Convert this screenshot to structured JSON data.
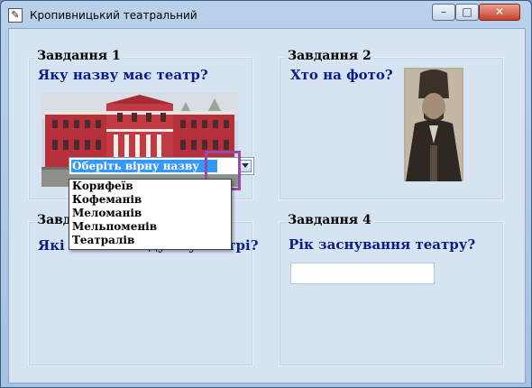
{
  "window": {
    "title": "Кропивницький театральний",
    "controls": {
      "minimize": "–",
      "maximize": "□",
      "close": "✕"
    }
  },
  "task1": {
    "title": "Завдання 1",
    "question": "Яку назву має театр?",
    "image": "theatre-building-photo",
    "select": {
      "value": "Оберіть вірну назву",
      "options": [
        "Корифеїв",
        "Кофеманів",
        "Меломанів",
        "Мельпоменів",
        "Театралів"
      ]
    }
  },
  "task2": {
    "title": "Завдання 2",
    "question": "Хто на фото?",
    "image": "portrait-photo"
  },
  "task3": {
    "title": "Завдання 3",
    "question": "Які вистави йдуть у театрі?"
  },
  "task4": {
    "title": "Завдання 4",
    "question": "Рік заснування театру?",
    "input": {
      "value": "",
      "placeholder": ""
    }
  },
  "colors": {
    "accent_highlight": "#9b48ad",
    "question_text": "#0a1b8a",
    "selection": "#3399ff"
  }
}
